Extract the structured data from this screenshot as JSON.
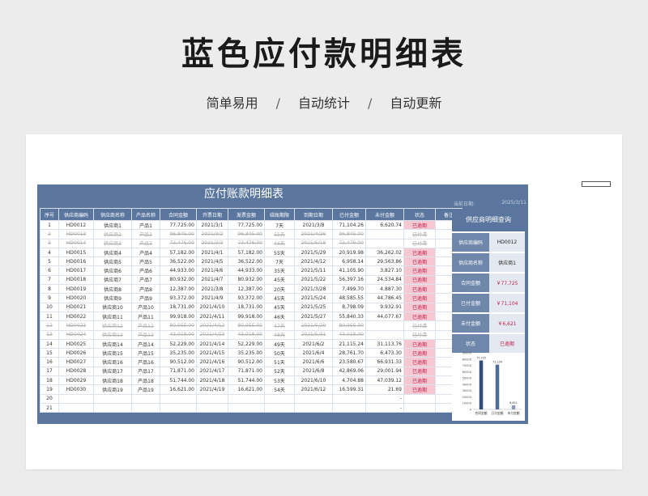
{
  "hero": {
    "title": "蓝色应付款明细表",
    "features": [
      "简单易用",
      "自动统计",
      "自动更新"
    ],
    "sep": "/"
  },
  "sheet": {
    "title": "应付账款明细表",
    "date_label": "当前日期:",
    "date_value": "2025/3/11",
    "columns": [
      "序号",
      "供应商编码",
      "供应商名称",
      "产品名称",
      "合同金额",
      "开票日期",
      "发票金额",
      "结账期限",
      "到期日期",
      "已付金额",
      "未付金额",
      "状态",
      "备注"
    ],
    "rows": [
      {
        "no": "1",
        "code": "HD0012",
        "supplier": "供应商1",
        "product": "产品1",
        "contract": "77,725.00",
        "inv_date": "2021/3/1",
        "inv_amt": "77,725.00",
        "term": "7天",
        "due": "2021/3/8",
        "paid": "71,104.26",
        "unpaid": "6,620.74",
        "status": "已逾期",
        "s": "od"
      },
      {
        "no": "2",
        "code": "HD0013",
        "supplier": "供应商2",
        "product": "产品2",
        "contract": "96,845.00",
        "inv_date": "2021/3/2",
        "inv_amt": "96,845.00",
        "term": "55天",
        "due": "2021/4/26",
        "paid": "96,845.00",
        "unpaid": "",
        "status": "已付清",
        "s": "paid"
      },
      {
        "no": "3",
        "code": "HD0014",
        "supplier": "供应商3",
        "product": "产品3",
        "contract": "73,476.00",
        "inv_date": "2021/3/3",
        "inv_amt": "73,476.00",
        "term": "46天",
        "due": "2021/5/18",
        "paid": "73,476.00",
        "unpaid": "",
        "status": "已付清",
        "s": "paid"
      },
      {
        "no": "4",
        "code": "HD0015",
        "supplier": "供应商4",
        "product": "产品4",
        "contract": "57,182.00",
        "inv_date": "2021/4/1",
        "inv_amt": "57,182.00",
        "term": "55天",
        "due": "2021/5/29",
        "paid": "20,919.98",
        "unpaid": "36,262.02",
        "status": "已逾期",
        "s": "od"
      },
      {
        "no": "5",
        "code": "HD0016",
        "supplier": "供应商5",
        "product": "产品5",
        "contract": "36,522.00",
        "inv_date": "2021/4/5",
        "inv_amt": "36,522.00",
        "term": "7天",
        "due": "2021/4/12",
        "paid": "6,958.14",
        "unpaid": "29,563.86",
        "status": "已逾期",
        "s": "od"
      },
      {
        "no": "6",
        "code": "HD0017",
        "supplier": "供应商6",
        "product": "产品6",
        "contract": "44,933.00",
        "inv_date": "2021/4/6",
        "inv_amt": "44,933.00",
        "term": "35天",
        "due": "2021/5/11",
        "paid": "41,105.90",
        "unpaid": "3,827.10",
        "status": "已逾期",
        "s": "od"
      },
      {
        "no": "7",
        "code": "HD0018",
        "supplier": "供应商7",
        "product": "产品7",
        "contract": "80,932.00",
        "inv_date": "2021/4/7",
        "inv_amt": "80,932.00",
        "term": "45天",
        "due": "2021/5/22",
        "paid": "56,397.16",
        "unpaid": "24,534.84",
        "status": "已逾期",
        "s": "od"
      },
      {
        "no": "8",
        "code": "HD0019",
        "supplier": "供应商8",
        "product": "产品8",
        "contract": "12,387.00",
        "inv_date": "2021/3/8",
        "inv_amt": "12,387.00",
        "term": "20天",
        "due": "2021/3/28",
        "paid": "7,499.70",
        "unpaid": "4,887.30",
        "status": "已逾期",
        "s": "od"
      },
      {
        "no": "9",
        "code": "HD0020",
        "supplier": "供应商9",
        "product": "产品9",
        "contract": "93,372.00",
        "inv_date": "2021/4/9",
        "inv_amt": "93,372.00",
        "term": "45天",
        "due": "2021/5/24",
        "paid": "48,585.55",
        "unpaid": "44,786.45",
        "status": "已逾期",
        "s": "od"
      },
      {
        "no": "10",
        "code": "HD0021",
        "supplier": "供应商10",
        "product": "产品10",
        "contract": "18,731.00",
        "inv_date": "2021/4/10",
        "inv_amt": "18,731.00",
        "term": "45天",
        "due": "2021/5/25",
        "paid": "8,798.09",
        "unpaid": "9,932.91",
        "status": "已逾期",
        "s": "od"
      },
      {
        "no": "11",
        "code": "HD0022",
        "supplier": "供应商11",
        "product": "产品11",
        "contract": "99,918.00",
        "inv_date": "2021/4/11",
        "inv_amt": "99,918.00",
        "term": "46天",
        "due": "2021/5/27",
        "paid": "55,840.33",
        "unpaid": "44,077.67",
        "status": "已逾期",
        "s": "od"
      },
      {
        "no": "12",
        "code": "HD0023",
        "supplier": "供应商12",
        "product": "产品12",
        "contract": "80,955.00",
        "inv_date": "2021/4/12",
        "inv_amt": "80,955.00",
        "term": "47天",
        "due": "2021/5/29",
        "paid": "80,955.00",
        "unpaid": "",
        "status": "已付清",
        "s": "paid"
      },
      {
        "no": "13",
        "code": "HD0024",
        "supplier": "供应商13",
        "product": "产品13",
        "contract": "43,018.00",
        "inv_date": "2021/4/13",
        "inv_amt": "43,018.00",
        "term": "48天",
        "due": "2021/5/31",
        "paid": "43,018.00",
        "unpaid": "",
        "status": "已付清",
        "s": "paid"
      },
      {
        "no": "14",
        "code": "HD0025",
        "supplier": "供应商14",
        "product": "产品14",
        "contract": "52,229.00",
        "inv_date": "2021/4/14",
        "inv_amt": "52,229.00",
        "term": "49天",
        "due": "2021/6/2",
        "paid": "21,115.24",
        "unpaid": "31,113.76",
        "status": "已逾期",
        "s": "od"
      },
      {
        "no": "15",
        "code": "HD0026",
        "supplier": "供应商15",
        "product": "产品15",
        "contract": "35,235.00",
        "inv_date": "2021/4/15",
        "inv_amt": "35,235.00",
        "term": "50天",
        "due": "2021/6/4",
        "paid": "28,761.70",
        "unpaid": "6,473.30",
        "status": "已逾期",
        "s": "od"
      },
      {
        "no": "16",
        "code": "HD0027",
        "supplier": "供应商16",
        "product": "产品16",
        "contract": "90,512.00",
        "inv_date": "2021/4/16",
        "inv_amt": "90,512.00",
        "term": "51天",
        "due": "2021/6/6",
        "paid": "23,580.67",
        "unpaid": "66,931.33",
        "status": "已逾期",
        "s": "od"
      },
      {
        "no": "17",
        "code": "HD0028",
        "supplier": "供应商17",
        "product": "产品17",
        "contract": "71,871.00",
        "inv_date": "2021/4/17",
        "inv_amt": "71,871.00",
        "term": "52天",
        "due": "2021/6/8",
        "paid": "42,869.06",
        "unpaid": "29,001.94",
        "status": "已逾期",
        "s": "od"
      },
      {
        "no": "18",
        "code": "HD0029",
        "supplier": "供应商18",
        "product": "产品18",
        "contract": "51,744.00",
        "inv_date": "2021/4/18",
        "inv_amt": "51,744.00",
        "term": "53天",
        "due": "2021/6/10",
        "paid": "4,704.88",
        "unpaid": "47,039.12",
        "status": "已逾期",
        "s": "od"
      },
      {
        "no": "19",
        "code": "HD0030",
        "supplier": "供应商19",
        "product": "产品19",
        "contract": "16,621.00",
        "inv_date": "2021/4/19",
        "inv_amt": "16,621.00",
        "term": "54天",
        "due": "2021/6/12",
        "paid": "16,599.31",
        "unpaid": "21.69",
        "status": "已逾期",
        "s": "od"
      },
      {
        "no": "20",
        "code": "",
        "supplier": "",
        "product": "",
        "contract": "",
        "inv_date": "",
        "inv_amt": "",
        "term": "",
        "due": "",
        "paid": "",
        "unpaid": "-",
        "status": "",
        "s": ""
      },
      {
        "no": "21",
        "code": "",
        "supplier": "",
        "product": "",
        "contract": "",
        "inv_date": "",
        "inv_amt": "",
        "term": "",
        "due": "",
        "paid": "",
        "unpaid": "-",
        "status": "",
        "s": ""
      }
    ]
  },
  "panel": {
    "title": "供应商明细查询",
    "fields": [
      {
        "label": "供应商编码",
        "value": "HD0012",
        "red": false
      },
      {
        "label": "供应商名称",
        "value": "供应商1",
        "red": false
      },
      {
        "label": "合同金额",
        "value": "￥77,725",
        "red": true
      },
      {
        "label": "已付金额",
        "value": "￥71,104",
        "red": true
      },
      {
        "label": "未付金额",
        "value": "￥6,621",
        "red": true
      },
      {
        "label": "状态",
        "value": "已逾期",
        "red": true
      }
    ]
  },
  "chart_data": {
    "type": "bar",
    "categories": [
      "合同金额",
      "已付金额",
      "未付金额"
    ],
    "values": [
      77725,
      71104,
      6621
    ],
    "data_labels": [
      "77,725",
      "71,104",
      "6,621"
    ],
    "ylim": [
      0,
      90000
    ],
    "yticks": [
      0,
      10000,
      20000,
      30000,
      40000,
      50000,
      60000,
      70000,
      80000,
      90000
    ],
    "colors": [
      "#2f4f78",
      "#4f6d96",
      "#8a9bb5"
    ]
  }
}
